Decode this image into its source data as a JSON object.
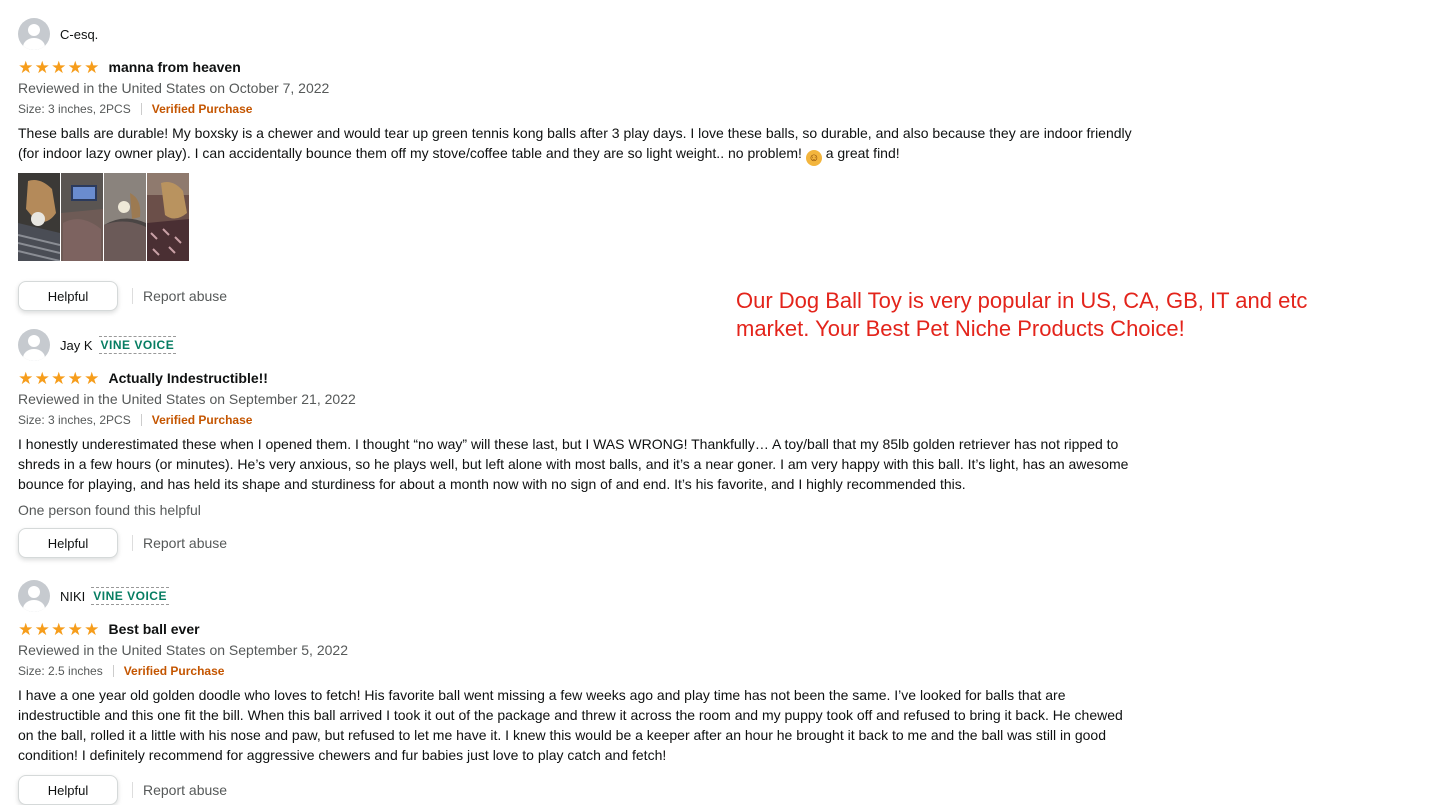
{
  "reviews": [
    {
      "name": "C-esq.",
      "vine": "",
      "title": "manna from heaven",
      "date": "Reviewed in the United States on October 7, 2022",
      "size": "Size: 3 inches, 2PCS",
      "verified": "Verified Purchase",
      "text_before_emoji": "These balls are durable! My boxsky is a chewer and would tear up green tennis kong balls after 3 play days. I love these balls, so durable, and also because they are indoor friendly (for indoor lazy owner play). I can accidentally bounce them off my stove/coffee table and they are so light weight.. no problem! ",
      "text_after_emoji": " a great find!",
      "helpful_label": "Helpful",
      "report_label": "Report abuse",
      "rating": 5
    },
    {
      "name": "Jay K",
      "vine": "VINE VOICE",
      "title": "Actually Indestructible!!",
      "date": "Reviewed in the United States on September 21, 2022",
      "size": "Size: 3 inches, 2PCS",
      "verified": "Verified Purchase",
      "text": "I honestly underestimated these when I opened them. I thought “no way” will these last, but I WAS WRONG! Thankfully… A toy/ball that my 85lb golden retriever has not ripped to shreds in a few hours (or minutes). He’s very anxious, so he plays well, but left alone with most balls, and it’s a near goner. I am very happy with this ball. It’s light, has an awesome bounce for playing, and has held its shape and sturdiness for about a month now with no sign of and end. It’s his favorite, and I highly recommended this.",
      "found_helpful": "One person found this helpful",
      "helpful_label": "Helpful",
      "report_label": "Report abuse",
      "rating": 5
    },
    {
      "name": "NIKI",
      "vine": "VINE VOICE",
      "title": "Best ball ever",
      "date": "Reviewed in the United States on September 5, 2022",
      "size": "Size: 2.5 inches",
      "verified": "Verified Purchase",
      "text": "I have a one year old golden doodle who loves to fetch! His favorite ball went missing a few weeks ago and play time has not been the same. I’ve looked for balls that are indestructible and this one fit the bill. When this ball arrived I took it out of the package and threw it across the room and my puppy took off and refused to bring it back. He chewed on the ball, rolled it a little with his nose and paw, but refused to let me have it. I knew this would be a keeper after an hour he brought it back to me and the ball was still in good condition! I definitely recommend for aggressive chewers and fur babies just love to play catch and fetch!",
      "helpful_label": "Helpful",
      "report_label": "Report abuse",
      "rating": 5
    }
  ],
  "promo": {
    "line1": "Our Dog Ball Toy is very popular in US, CA, GB, IT and etc",
    "line2": "market. Your Best Pet Niche Products Choice!"
  },
  "colors": {
    "star": "#f69d1b",
    "verified": "#c45500",
    "vine": "#067d62",
    "promo": "#e3241b"
  }
}
